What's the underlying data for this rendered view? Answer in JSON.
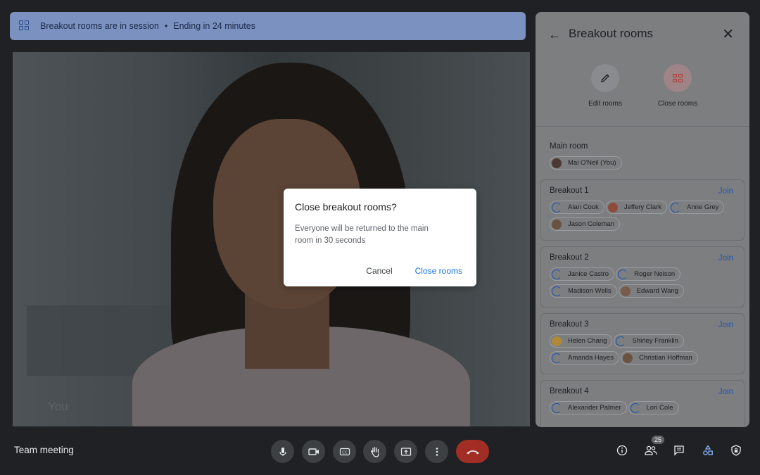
{
  "banner": {
    "text": "Breakout rooms are in session",
    "separator": "•",
    "ending": "Ending in 24 minutes"
  },
  "video": {
    "self_label": "You"
  },
  "dialog": {
    "title": "Close breakout rooms?",
    "body": "Everyone will be returned to the main room in 30 seconds",
    "cancel": "Cancel",
    "confirm": "Close rooms"
  },
  "panel": {
    "title": "Breakout rooms",
    "edit_label": "Edit rooms",
    "close_label": "Close rooms",
    "main_room": {
      "title": "Main room",
      "members": [
        "Mai O'Neil (You)"
      ]
    },
    "join_label": "Join",
    "rooms": [
      {
        "title": "Breakout 1",
        "members": [
          "Alan Cook",
          "Jeffery Clark",
          "Anne Grey",
          "Jason Coleman"
        ]
      },
      {
        "title": "Breakout 2",
        "members": [
          "Janice Castro",
          "Roger Nelson",
          "Madison Wells",
          "Edward Wang"
        ]
      },
      {
        "title": "Breakout 3",
        "members": [
          "Helen Chang",
          "Shirley Franklin",
          "Amanda Hayes",
          "Christian Hoffman"
        ]
      },
      {
        "title": "Breakout 4",
        "members": [
          "Alexander Palmer",
          "Lori Cole"
        ]
      }
    ]
  },
  "footer": {
    "meeting_name": "Team meeting",
    "participant_count": "25"
  },
  "colors": {
    "accent": "#1a73e8",
    "hangup": "#a22d24",
    "banner": "#7b92c0"
  }
}
